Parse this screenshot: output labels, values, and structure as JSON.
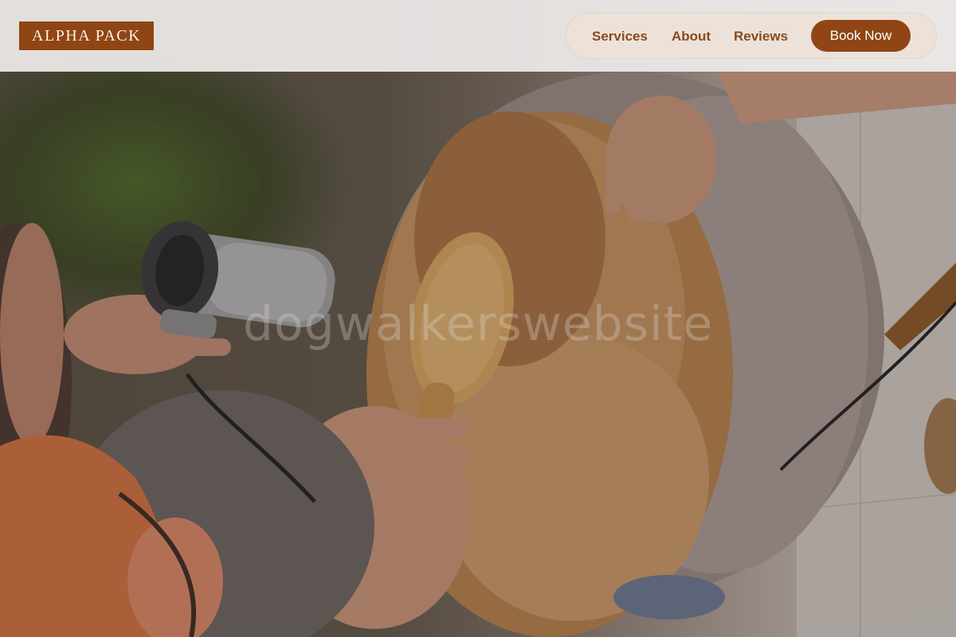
{
  "brand": {
    "logo_text": "ALPHA PACK"
  },
  "nav": {
    "links": [
      "Services",
      "About",
      "Reviews"
    ],
    "cta_label": "Book Now"
  },
  "hero": {
    "image_alt": "Groomer brushing and blow-drying a golden dog's fur",
    "watermark": "dogwalkerswebsite"
  },
  "colors": {
    "brand_brown": "#8f4614",
    "nav_text": "#8a4a1d",
    "header_bg": "#eeebe9",
    "nav_pill_bg": "#ece2da"
  },
  "icons": {
    "hair_dryer": "hair-dryer-illustration",
    "brush": "wooden-brush-illustration"
  }
}
